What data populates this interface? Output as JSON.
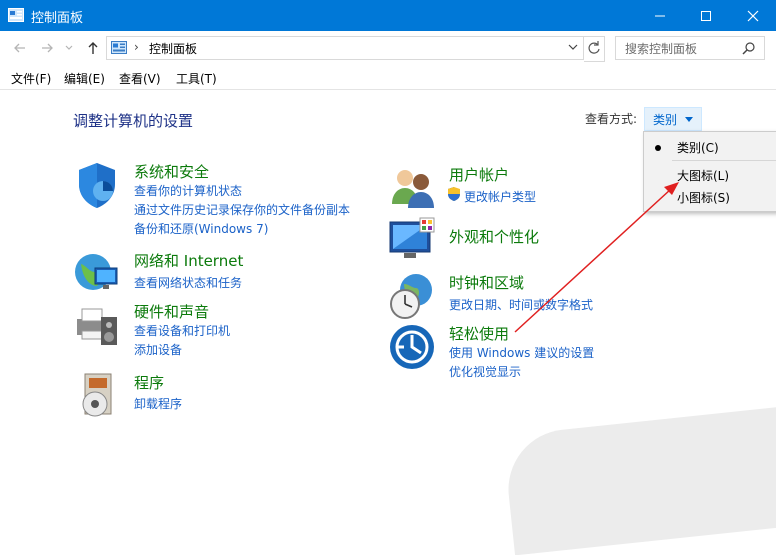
{
  "window": {
    "title": "控制面板",
    "controls": {
      "minimize_icon": "minimize-icon",
      "maximize_icon": "maximize-icon",
      "close_icon": "close-icon"
    }
  },
  "address": {
    "crumb": "控制面板",
    "separator": "›",
    "search_placeholder": "搜索控制面板"
  },
  "menubar": {
    "file": "文件(F)",
    "edit": "编辑(E)",
    "view": "查看(V)",
    "tools": "工具(T)"
  },
  "main": {
    "title": "调整计算机的设置",
    "view_by_label": "查看方式:",
    "view_by_value": "类别"
  },
  "categories_left": [
    {
      "name": "系统和安全",
      "links": [
        "查看你的计算机状态",
        "通过文件历史记录保存你的文件备份副本",
        "备份和还原(Windows 7)"
      ]
    },
    {
      "name": "网络和 Internet",
      "links": [
        "查看网络状态和任务"
      ]
    },
    {
      "name": "硬件和声音",
      "links": [
        "查看设备和打印机",
        "添加设备"
      ]
    },
    {
      "name": "程序",
      "links": [
        "卸载程序"
      ]
    }
  ],
  "categories_right": [
    {
      "name": "用户帐户",
      "links": [
        "更改帐户类型"
      ]
    },
    {
      "name": "外观和个性化",
      "links": []
    },
    {
      "name": "时钟和区域",
      "links": [
        "更改日期、时间或数字格式"
      ]
    },
    {
      "name": "轻松使用",
      "links": [
        "使用 Windows 建议的设置",
        "优化视觉显示"
      ]
    }
  ],
  "view_menu": {
    "items": [
      {
        "label": "类别(C)",
        "selected": true
      },
      {
        "label": "大图标(L)",
        "selected": false
      },
      {
        "label": "小图标(S)",
        "selected": false
      }
    ]
  },
  "colors": {
    "titlebar": "#0078d7",
    "heading": "#1e3287",
    "category": "#0b7a0b",
    "link": "#1b62c8",
    "annotation_arrow": "#e02020"
  }
}
